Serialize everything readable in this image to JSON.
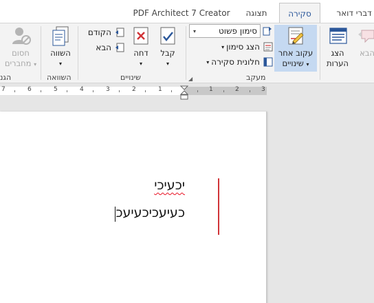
{
  "tabs": [
    {
      "label": "דברי דואר",
      "active": false
    },
    {
      "label": "סקירה",
      "active": true
    },
    {
      "label": "תצוגה",
      "active": false
    },
    {
      "label": "PDF Architect 7 Creator",
      "active": false
    }
  ],
  "ribbon": {
    "tracking": {
      "group_label": "מעקב",
      "track_changes": {
        "line1": "עקוב אחר",
        "line2": "שינויים"
      },
      "markup_dropdown": {
        "value": "סימון פשוט"
      },
      "show_markup": "הצג סימון",
      "reviewing_pane": "חלונית סקירה"
    },
    "changes": {
      "group_label": "שינויים",
      "accept": "קבל",
      "reject": "דחה",
      "previous": "הקודם",
      "next": "הבא"
    },
    "compare": {
      "group_label": "השוואה",
      "compare": "השווה"
    },
    "protect": {
      "group_label": "הגנ",
      "block_authors": {
        "line1": "חסום",
        "line2": "מחברים"
      }
    },
    "comments": {
      "show_comments": {
        "line1": "הצג",
        "line2": "הערות"
      },
      "next": "הבא"
    }
  },
  "ruler": {
    "numbers": [
      "7",
      "6",
      "5",
      "4",
      "3",
      "2",
      "1",
      "1",
      "2",
      "3"
    ]
  },
  "document": {
    "lines": [
      "יכעיכי",
      "כעיעכיכעיעכ"
    ]
  },
  "colors": {
    "accent": "#2b579a",
    "change_bar": "#d13438",
    "spell_underline": "#e81123"
  }
}
